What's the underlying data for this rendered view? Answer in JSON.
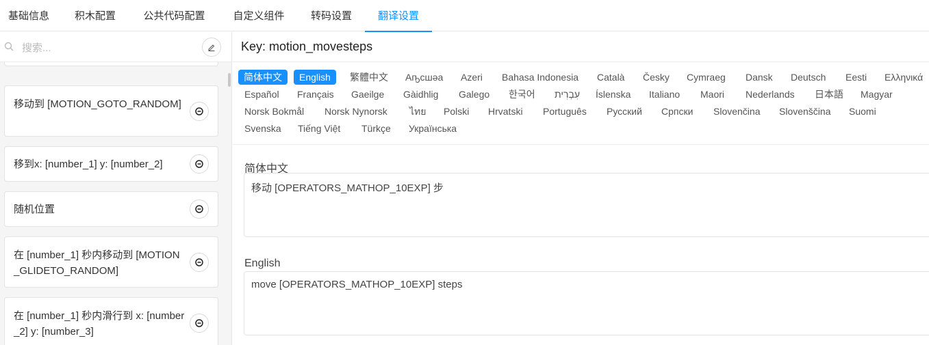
{
  "tabs": [
    {
      "label": "基础信息"
    },
    {
      "label": "积木配置"
    },
    {
      "label": "公共代码配置"
    },
    {
      "label": "自定义组件"
    },
    {
      "label": "转码设置"
    },
    {
      "label": "翻译设置"
    }
  ],
  "sidebar": {
    "search_placeholder": "搜索...",
    "items": [
      {
        "label": "移动到 [MOTION_GOTO_RANDOM]"
      },
      {
        "label": "移到x: [number_1] y: [number_2]"
      },
      {
        "label": "随机位置"
      },
      {
        "label": "在 [number_1] 秒内移动到 [MOTION_GLIDETO_RANDOM]"
      },
      {
        "label": "在 [number_1] 秒内滑行到 x: [number_2] y: [number_3]"
      }
    ]
  },
  "main": {
    "key_title": "Key: motion_movesteps",
    "languages": [
      "简体中文",
      "English",
      "繁體中文",
      "Аҧсшәа",
      "Azeri",
      "Bahasa Indonesia",
      "Català",
      "Česky",
      "Cymraeg",
      "Dansk",
      "Deutsch",
      "Eesti",
      "Ελληνικά",
      "Español",
      "Français",
      "Gaeilge",
      "Gàidhlig",
      "Galego",
      "한국어",
      "עִבְרִית",
      "Íslenska",
      "Italiano",
      "Maori",
      "Nederlands",
      "日本語",
      "Magyar",
      "Norsk Bokmål",
      "Norsk Nynorsk",
      "ไทย",
      "Polski",
      "Hrvatski",
      "Português",
      "Русский",
      "Српски",
      "Slovenčina",
      "Slovenščina",
      "Suomi",
      "Svenska",
      "Tiếng Việt",
      "Türkçe",
      "Українська"
    ],
    "fields": [
      {
        "label": "简体中文",
        "value": "移动 [OPERATORS_MATHOP_10EXP] 步"
      },
      {
        "label": "English",
        "value": "move [OPERATORS_MATHOP_10EXP] steps"
      }
    ]
  },
  "colors": {
    "accent": "#1890ff"
  }
}
